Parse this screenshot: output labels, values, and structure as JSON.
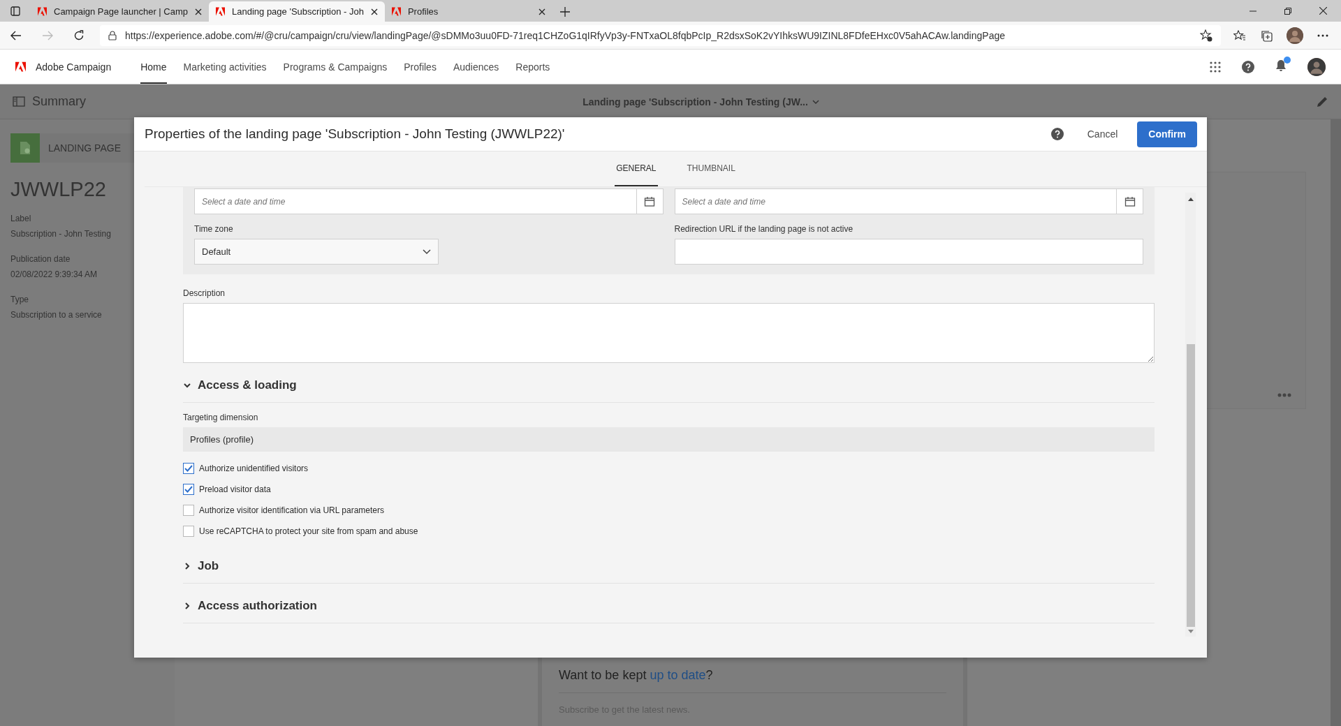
{
  "browser": {
    "tabs": [
      {
        "title": "Campaign Page launcher | Camp",
        "selected": false
      },
      {
        "title": "Landing page 'Subscription - Joh",
        "selected": true
      },
      {
        "title": "Profiles",
        "selected": false
      }
    ],
    "url": "https://experience.adobe.com/#/@cru/campaign/cru/view/landingPage/@sDMMo3uu0FD-71req1CHZoG1qIRfyVp3y-FNTxaOL8fqbPcIp_R2dsxSoK2vYIhksWU9IZINL8FDfeEHxc0V5ahACAw.landingPage"
  },
  "app_header": {
    "product": "Adobe Campaign",
    "nav": [
      {
        "label": "Home",
        "selected": true
      },
      {
        "label": "Marketing activities",
        "selected": false
      },
      {
        "label": "Programs & Campaigns",
        "selected": false
      },
      {
        "label": "Profiles",
        "selected": false
      },
      {
        "label": "Audiences",
        "selected": false
      },
      {
        "label": "Reports",
        "selected": false
      }
    ]
  },
  "summary_bar": {
    "title": "Summary",
    "page_title": "Landing page 'Subscription - John Testing (JW..."
  },
  "summary_panel": {
    "badge": "LANDING PAGE",
    "name": "JWWLP22",
    "fields": [
      {
        "label": "Label",
        "value": "Subscription - John Testing"
      },
      {
        "label": "Publication date",
        "value": "02/08/2022 9:39:34 AM"
      },
      {
        "label": "Type",
        "value": "Subscription to a service"
      }
    ]
  },
  "preview": {
    "heading": "Want to be kept ",
    "heading_link": "up to date",
    "heading_end": "?",
    "subtext": "Subscribe to get the latest news."
  },
  "modal": {
    "title": "Properties of the landing page 'Subscription - John Testing (JWWLP22)'",
    "cancel": "Cancel",
    "confirm": "Confirm",
    "tabs": [
      {
        "label": "GENERAL",
        "selected": true
      },
      {
        "label": "THUMBNAIL",
        "selected": false
      }
    ],
    "date_fields": [
      {
        "placeholder": "Select a date and time"
      },
      {
        "placeholder": "Select a date and time"
      }
    ],
    "time_zone": {
      "label": "Time zone",
      "value": "Default"
    },
    "redirection": {
      "label": "Redirection URL if the landing page is not active"
    },
    "description": {
      "label": "Description"
    },
    "sections": [
      {
        "title": "Access & loading",
        "expanded": true,
        "targeting": {
          "label": "Targeting dimension",
          "value": "Profiles (profile)"
        },
        "checkboxes": [
          {
            "label": "Authorize unidentified visitors",
            "checked": true
          },
          {
            "label": "Preload visitor data",
            "checked": true
          },
          {
            "label": "Authorize visitor identification via URL parameters",
            "checked": false
          },
          {
            "label": "Use reCAPTCHA to protect your site from spam and abuse",
            "checked": false
          }
        ]
      },
      {
        "title": "Job",
        "expanded": false
      },
      {
        "title": "Access authorization",
        "expanded": false
      }
    ]
  }
}
